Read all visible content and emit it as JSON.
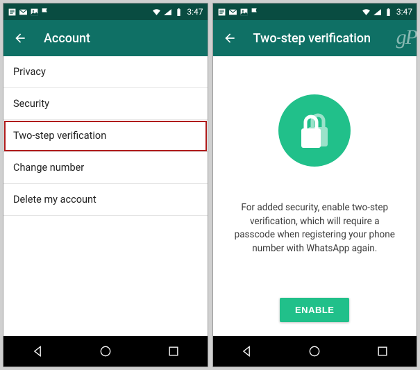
{
  "status": {
    "time": "3:47"
  },
  "left": {
    "title": "Account",
    "items": [
      {
        "label": "Privacy"
      },
      {
        "label": "Security"
      },
      {
        "label": "Two-step verification"
      },
      {
        "label": "Change number"
      },
      {
        "label": "Delete my account"
      }
    ]
  },
  "right": {
    "title": "Two-step verification",
    "body": "For added security, enable two-step verification, which will require a passcode when registering your phone number with WhatsApp again.",
    "enable_label": "ENABLE",
    "watermark": "gP"
  }
}
